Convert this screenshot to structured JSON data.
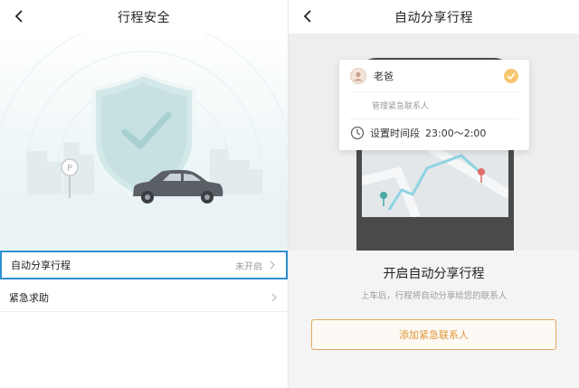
{
  "left": {
    "nav": {
      "title": "行程安全"
    },
    "rows": [
      {
        "label": "自动分享行程",
        "status": "未开启"
      },
      {
        "label": "紧急求助",
        "status": ""
      }
    ]
  },
  "right": {
    "nav": {
      "title": "自动分享行程"
    },
    "card": {
      "contact_name": "老爸",
      "manage_label": "管理紧急联系人",
      "time_label": "设置时间段",
      "time_range": "23:00～2:00"
    },
    "heading": "开启自动分享行程",
    "subheading": "上车后，行程将自动分享给您的联系人",
    "cta_label": "添加紧急联系人"
  },
  "colors": {
    "accent_orange": "#e0953a",
    "check_yellow": "#f6c66f",
    "selection_blue": "#2d8fd3",
    "shield": "#c9e3e4"
  },
  "icons": [
    "back-arrow-icon",
    "shield-check-icon",
    "car-icon",
    "parking-sign-icon",
    "chevron-right-icon",
    "avatar-icon",
    "checkmark-icon",
    "clock-icon",
    "map-pin-icon"
  ]
}
